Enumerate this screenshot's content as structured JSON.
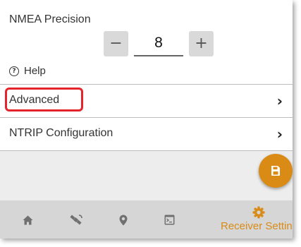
{
  "settings": {
    "nmea_label": "NMEA Precision",
    "precision_value": "8",
    "minus_label": "−",
    "plus_label": "+",
    "help_icon_glyph": "?",
    "help_label": "Help"
  },
  "menu": {
    "rows": [
      {
        "label": "Advanced",
        "chevron": "›",
        "highlighted": true
      },
      {
        "label": "NTRIP Configuration",
        "chevron": "›",
        "highlighted": false
      }
    ]
  },
  "fab": {
    "icon": "save-icon",
    "color": "#d98b16"
  },
  "bottom_nav": {
    "items": [
      {
        "icon": "home-icon"
      },
      {
        "icon": "satellite-icon"
      },
      {
        "icon": "location-pin-icon"
      },
      {
        "icon": "terminal-icon"
      },
      {
        "icon": "gear-icon",
        "label": "Receiver Settings",
        "active": true
      }
    ]
  },
  "colors": {
    "accent": "#d98b16",
    "highlight_border": "#e3242b",
    "nav_background": "#d6d6d6",
    "nav_icon": "#707070"
  }
}
